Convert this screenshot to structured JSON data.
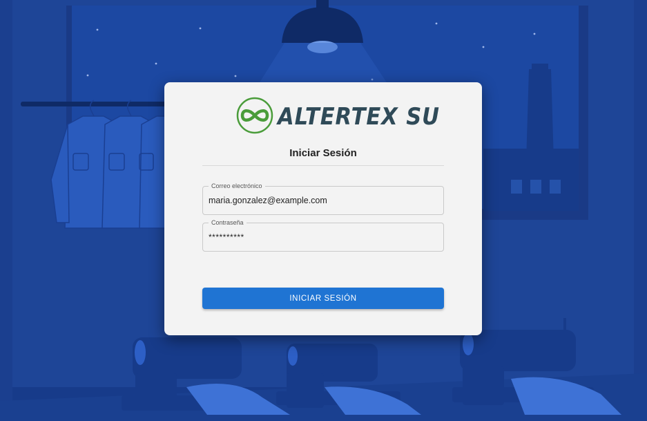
{
  "brand": {
    "name": "ALTERTEX SU",
    "logo_icon": "infinity-circle-icon",
    "logo_color": "#4a9c3a"
  },
  "login": {
    "title": "Iniciar Sesión",
    "email_label": "Correo electrónico",
    "email_value": "maria.gonzalez@example.com",
    "password_label": "Contraseña",
    "password_value": "**********",
    "submit_label": "INICIAR SESIÓN"
  },
  "colors": {
    "background": "#1b3f8f",
    "card": "#f3f3f3",
    "button": "#1f74d3"
  }
}
